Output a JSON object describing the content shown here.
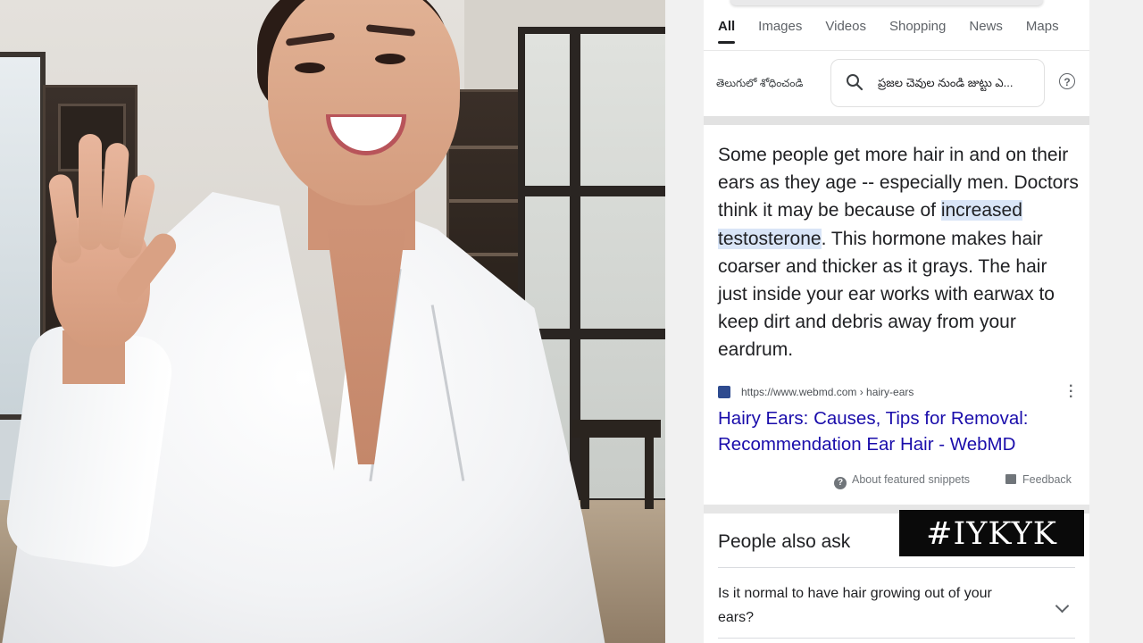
{
  "tabs": [
    "All",
    "Images",
    "Videos",
    "Shopping",
    "News",
    "Maps"
  ],
  "language_link": "తెలుగులో శోధించండి",
  "telugu_query": "ప్రజల చెవుల నుండి జుట్టు ఎ...",
  "snippet": {
    "before": "Some people get more hair in and on their ears as they age -- especially men. Doctors think it may be because of ",
    "highlight": "increased testosterone",
    "after": ". This hormone makes hair coarser and thicker as it grays. The hair just inside your ear works with earwax to keep dirt and debris away from your eardrum."
  },
  "source": {
    "url": "https://www.webmd.com › hairy-ears",
    "title": "Hairy Ears: Causes, Tips for Removal: Recommendation Ear Hair - WebMD"
  },
  "footer": {
    "about": "About featured snippets",
    "feedback": "Feedback"
  },
  "people_also_ask": {
    "title": "People also ask",
    "questions": [
      "Is it normal to have hair growing out of your ears?"
    ]
  },
  "overlay_tag": "#IYKYK",
  "colors": {
    "link_blue": "#1a0dab",
    "highlight": "#d9e5f7",
    "tag_bg": "#0a0a0a"
  },
  "icons": [
    "search-icon",
    "help-icon",
    "favicon-icon",
    "more-vert-icon",
    "info-icon",
    "feedback-icon",
    "chevron-down-icon"
  ]
}
